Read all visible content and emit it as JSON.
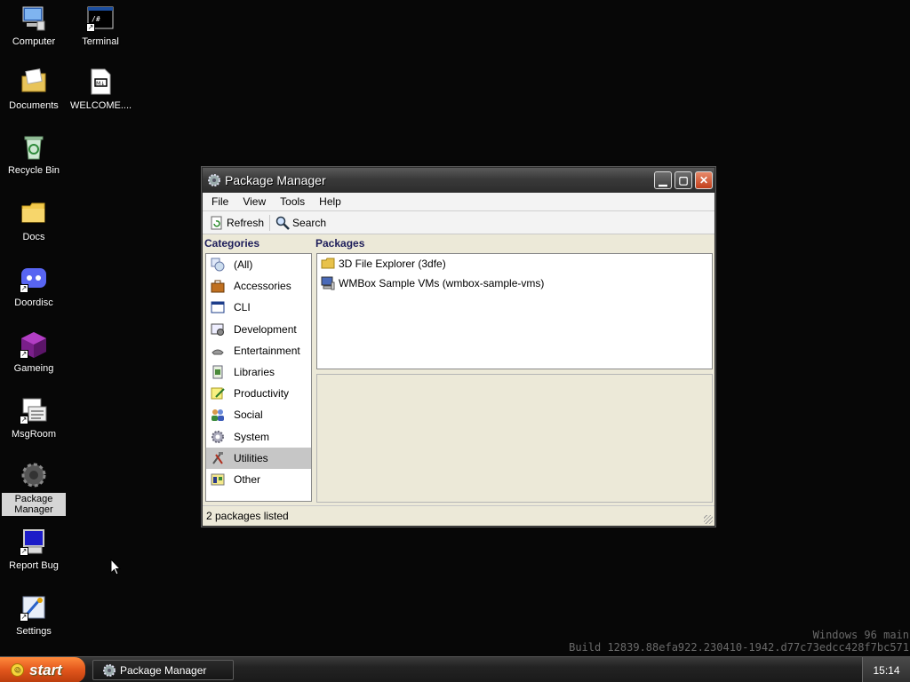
{
  "desktop": {
    "icons": [
      {
        "id": "computer",
        "label": "Computer",
        "icon": "computer-icon"
      },
      {
        "id": "terminal",
        "label": "Terminal",
        "icon": "terminal-icon"
      },
      {
        "id": "documents",
        "label": "Documents",
        "icon": "documents-icon"
      },
      {
        "id": "welcome",
        "label": "WELCOME....",
        "icon": "markdown-file-icon"
      },
      {
        "id": "recycle",
        "label": "Recycle Bin",
        "icon": "recycle-bin-icon"
      },
      {
        "id": "docs",
        "label": "Docs",
        "icon": "folder-icon"
      },
      {
        "id": "doordisc",
        "label": "Doordisc",
        "icon": "doordisc-icon"
      },
      {
        "id": "gameing",
        "label": "Gameing",
        "icon": "cube-icon"
      },
      {
        "id": "msgroom",
        "label": "MsgRoom",
        "icon": "msgroom-icon"
      },
      {
        "id": "package_manager",
        "label": "Package Manager",
        "icon": "package-manager-icon"
      },
      {
        "id": "report_bug",
        "label": "Report Bug",
        "icon": "report-bug-icon"
      },
      {
        "id": "settings",
        "label": "Settings",
        "icon": "settings-icon"
      }
    ]
  },
  "window": {
    "title": "Package Manager",
    "menu": [
      "File",
      "View",
      "Tools",
      "Help"
    ],
    "toolbar": {
      "refresh": "Refresh",
      "search": "Search"
    },
    "categories_header": "Categories",
    "packages_header": "Packages",
    "categories": [
      {
        "label": "(All)",
        "icon": "all-icon"
      },
      {
        "label": "Accessories",
        "icon": "briefcase-icon"
      },
      {
        "label": "CLI",
        "icon": "cli-window-icon"
      },
      {
        "label": "Development",
        "icon": "development-icon"
      },
      {
        "label": "Entertainment",
        "icon": "entertainment-icon"
      },
      {
        "label": "Libraries",
        "icon": "library-icon"
      },
      {
        "label": "Productivity",
        "icon": "productivity-icon"
      },
      {
        "label": "Social",
        "icon": "social-icon"
      },
      {
        "label": "System",
        "icon": "system-gear-icon"
      },
      {
        "label": "Utilities",
        "icon": "utilities-tools-icon",
        "selected": true
      },
      {
        "label": "Other",
        "icon": "other-icon"
      }
    ],
    "packages": [
      {
        "label": "3D File Explorer (3dfe)",
        "icon": "folder-icon"
      },
      {
        "label": "WMBox Sample VMs (wmbox-sample-vms)",
        "icon": "computer-icon"
      }
    ],
    "status": "2 packages listed"
  },
  "watermark": {
    "line1": "Windows 96 main",
    "line2": "Build 12839.88efa922.230410-1942.d77c73edcc428f7bc571"
  },
  "taskbar": {
    "start_label": "start",
    "task_label": "Package Manager",
    "clock": "15:14"
  },
  "colors": {
    "desktop": "#070707",
    "start_button": "#e2561c",
    "window_body": "#ece9d8",
    "selected_category": "#c6c6c6"
  }
}
